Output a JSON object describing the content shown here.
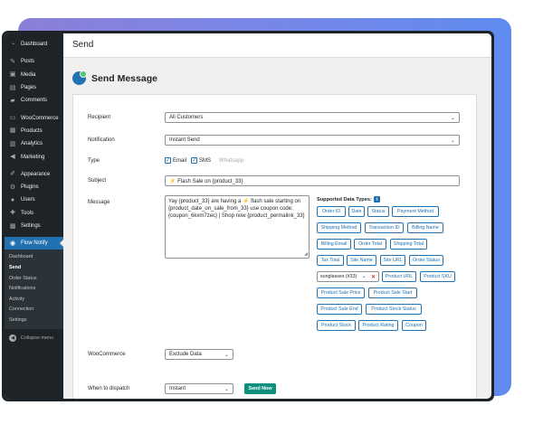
{
  "colors": {
    "accent": "#2271b1",
    "send_button": "#0d8f7d",
    "sidebar": "#1d2327",
    "remove": "#d63638"
  },
  "sidebar": {
    "items": [
      {
        "label": "Dashboard",
        "icon": "dashboard-icon"
      },
      {
        "label": "Posts",
        "icon": "pin-icon"
      },
      {
        "label": "Media",
        "icon": "media-icon"
      },
      {
        "label": "Pages",
        "icon": "page-icon"
      },
      {
        "label": "Comments",
        "icon": "comment-icon"
      },
      {
        "label": "WooCommerce",
        "icon": "woocommerce-icon"
      },
      {
        "label": "Products",
        "icon": "archive-icon"
      },
      {
        "label": "Analytics",
        "icon": "bar-chart-icon"
      },
      {
        "label": "Marketing",
        "icon": "megaphone-icon"
      },
      {
        "label": "Appearance",
        "icon": "brush-icon"
      },
      {
        "label": "Plugins",
        "icon": "plugin-icon"
      },
      {
        "label": "Users",
        "icon": "user-icon"
      },
      {
        "label": "Tools",
        "icon": "wrench-icon"
      },
      {
        "label": "Settings",
        "icon": "settings-icon"
      },
      {
        "label": "Flow Notify",
        "icon": "flow-notify-icon"
      }
    ],
    "submenu": [
      "Dashboard",
      "Send",
      "Order Status",
      "Notifications",
      "Activity",
      "Connection",
      "Settings"
    ],
    "collapse_label": "Collapse menu"
  },
  "page": {
    "title": "Send",
    "heading": "Send Message"
  },
  "form": {
    "recipient_label": "Recipient",
    "recipient_value": "All Customers",
    "notification_label": "Notification",
    "notification_value": "Instant Send",
    "type_label": "Type",
    "type_email": "Email",
    "type_sms": "SMS",
    "type_whatsapp": "Whatsapp",
    "subject_label": "Subject",
    "subject_value": "⚡ Flash Sale on {product_33}",
    "message_label": "Message",
    "message_value": "Yay {product_33} are having a ⚡ flash sale starting on {product_date_on_sale_from_33} use coupon code: {coupon_6kxm7zec} | Shop now {product_permalink_33}",
    "supported_title": "Supported Data Types:",
    "chips": {
      "order_id": "Order ID",
      "date": "Date",
      "status": "Status",
      "payment_method": "Payment Method",
      "shipping_method": "Shipping Method",
      "transaction_id": "Transaction ID",
      "billing_name": "Billing Name",
      "billing_email": "Billing Email",
      "order_total": "Order Total",
      "shipping_total": "Shipping Total",
      "tax_total": "Tax Total",
      "site_name": "Site Name",
      "site_url": "Site URL",
      "order_status": "Order Status",
      "product_url": "Product URL",
      "product_sku": "Product SKU",
      "product_sale_price": "Product Sale Price",
      "product_sale_start": "Product Sale Start",
      "product_sale_end": "Product Sale End",
      "product_stock_status": "Product Stock Status",
      "product_stock": "Product Stock",
      "product_rating": "Product Rating",
      "coupon": "Coupon"
    },
    "product_select_value": "sunglasses (#33)",
    "woocommerce_label": "WooCommerce",
    "woocommerce_value": "Exclude Data",
    "dispatch_label": "When to dispatch",
    "dispatch_value": "Instant",
    "send_button": "Send Now"
  }
}
